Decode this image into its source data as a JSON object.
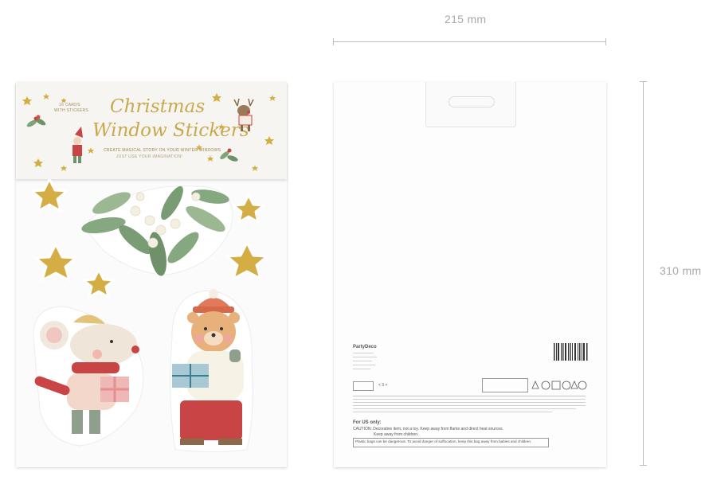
{
  "dimensions": {
    "width_label": "215 mm",
    "height_label": "310 mm"
  },
  "front": {
    "small_label_1": "16 CARDS",
    "small_label_2": "WITH STICKERS",
    "title_line_1": "Christmas",
    "title_line_2": "Window Stickers",
    "subtitle": "CREATE MAGICAL STORY ON YOUR WINTER WINDOWS",
    "subtitle_2": "JUST USE YOUR IMAGINATION!",
    "stickers": [
      "mistletoe",
      "gold stars",
      "mouse with gift",
      "bear with gift"
    ]
  },
  "back": {
    "brand": "PartyDeco",
    "age_label": "< 3 +",
    "for_us_title": "For US only:",
    "caution_line_1": "CAUTION: Decorative item, not a toy. Keep away from flame and direct heat sources.",
    "caution_line_2": "Keep away from children.",
    "plastic_warning": "Plastic bags can be dangerous. To avoid danger of suffocation, keep this bag away from babies and children."
  },
  "colors": {
    "gold": "#c9a94c",
    "star": "#d4ae45",
    "leaf": "#7fa37a",
    "dimension": "#a9a9a9"
  }
}
